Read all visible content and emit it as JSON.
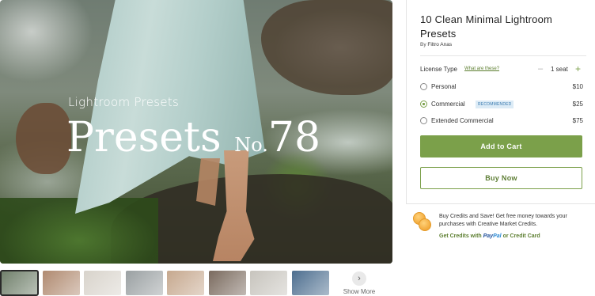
{
  "hero": {
    "overlay_subtitle": "Lightroom Presets",
    "overlay_title": "Presets",
    "overlay_no": "No.",
    "overlay_number": "78"
  },
  "thumbnails": {
    "count": 8,
    "active_index": 0,
    "colors": [
      "#6f7f6a",
      "#b08a70",
      "#d8d3cb",
      "#9aa0a2",
      "#c6a88e",
      "#7a6a5e",
      "#c7c4bd",
      "#4d6e8f"
    ],
    "show_more_label": "Show More"
  },
  "product": {
    "title": "10 Clean Minimal Lightroom Presets",
    "by_label": "By",
    "author": "Filtro Anas"
  },
  "license": {
    "label": "License Type",
    "help_link": "What are these?",
    "seat_label": "1 seat",
    "options": [
      {
        "label": "Personal",
        "price": "$10",
        "selected": false,
        "badge": ""
      },
      {
        "label": "Commercial",
        "price": "$25",
        "selected": true,
        "badge": "RECOMMENDED"
      },
      {
        "label": "Extended Commercial",
        "price": "$75",
        "selected": false,
        "badge": ""
      }
    ]
  },
  "actions": {
    "add_to_cart": "Add to Cart",
    "buy_now": "Buy Now"
  },
  "credits": {
    "promo_text": "Buy Credits and Save! Get free money towards your purchases with Creative Market Credits.",
    "link_prefix": "Get Credits with",
    "paypal_pay": "Pay",
    "paypal_pal": "Pal",
    "link_suffix": "or Credit Card"
  },
  "colors": {
    "accent": "#7ba04a",
    "badge_bg": "#dcebf6",
    "badge_text": "#3b7bb0"
  }
}
